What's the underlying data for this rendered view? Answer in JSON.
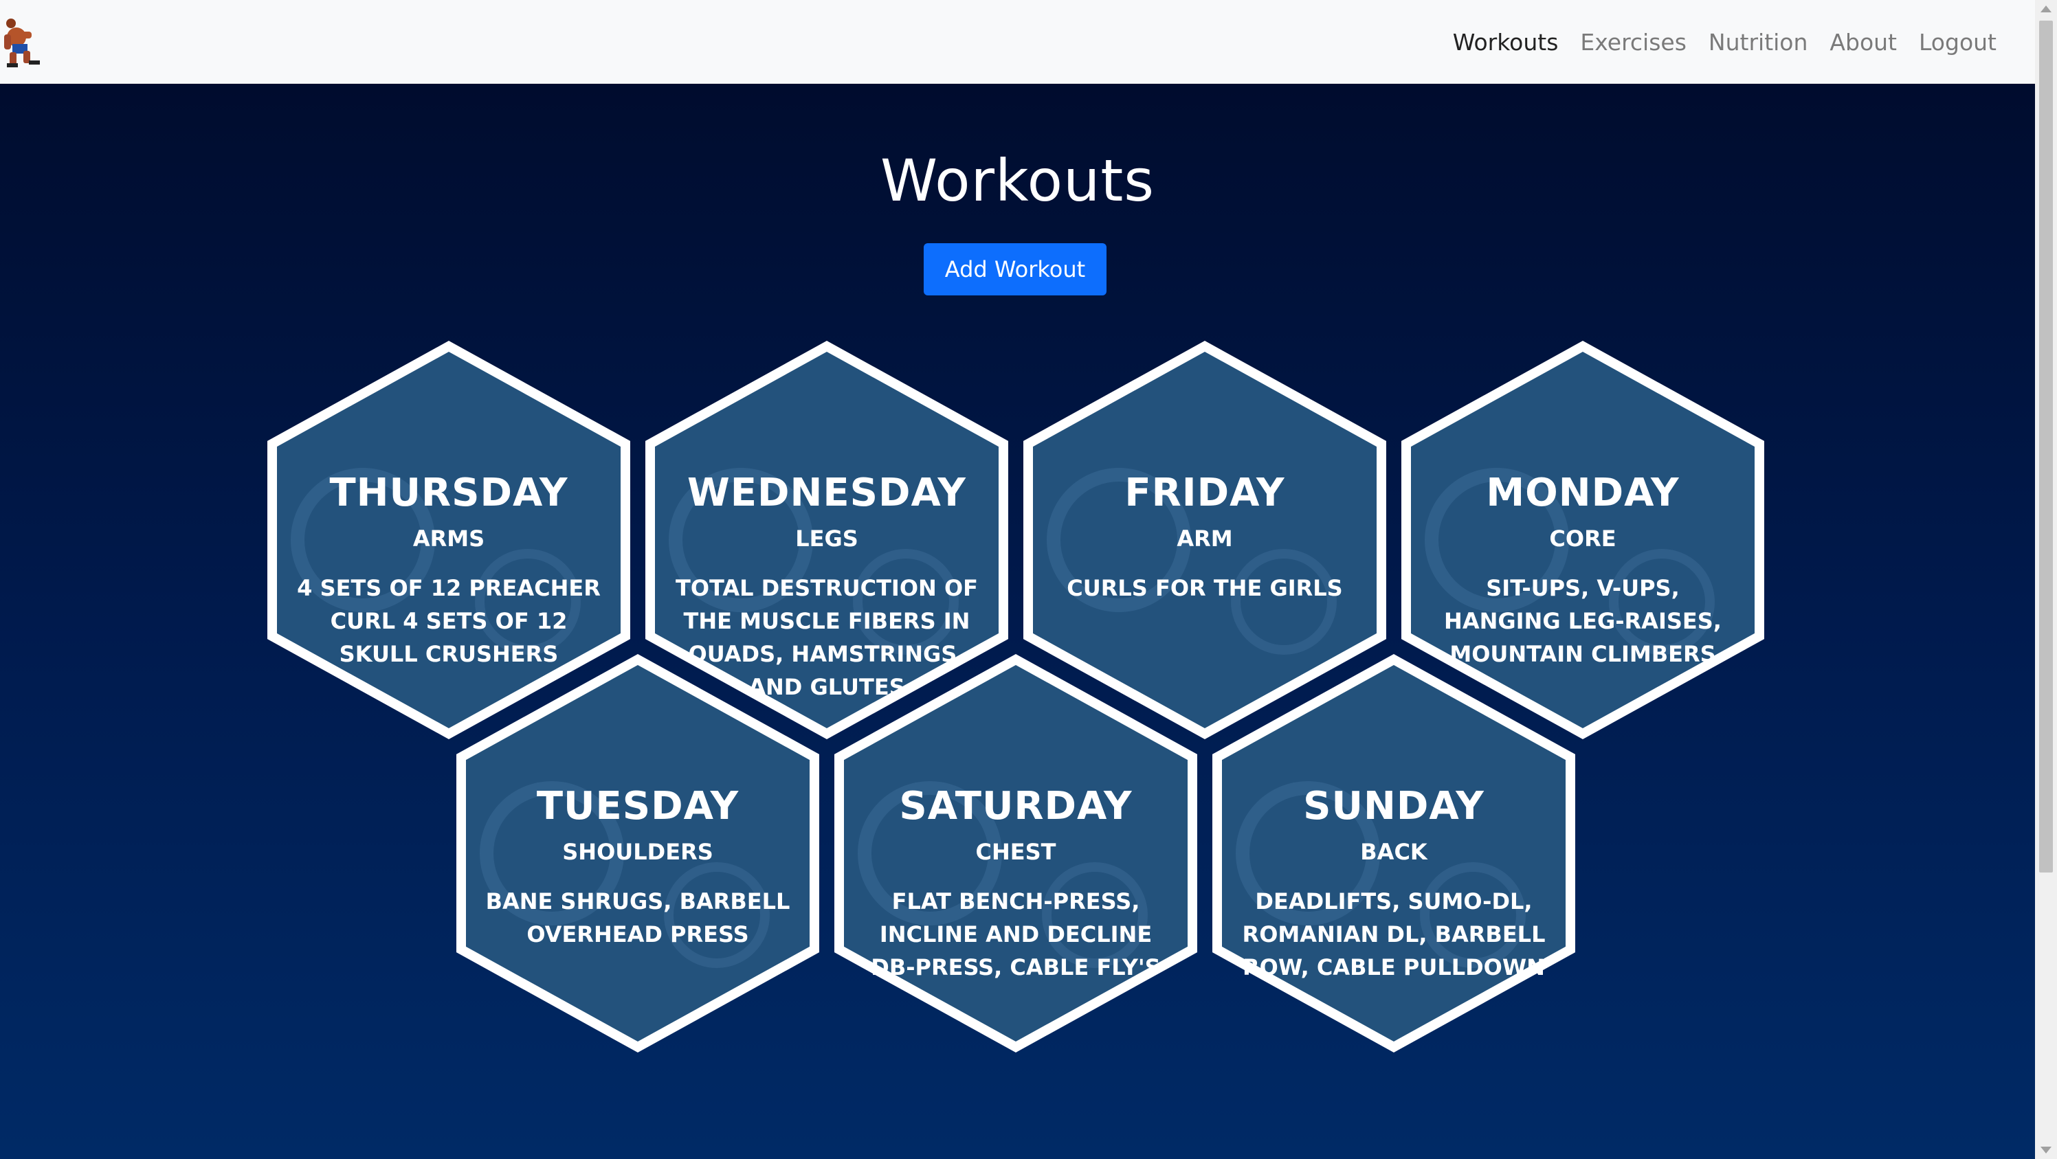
{
  "nav": {
    "items": [
      {
        "label": "Workouts",
        "active": true
      },
      {
        "label": "Exercises",
        "active": false
      },
      {
        "label": "Nutrition",
        "active": false
      },
      {
        "label": "About",
        "active": false
      },
      {
        "label": "Logout",
        "active": false
      }
    ]
  },
  "page": {
    "title": "Workouts",
    "add_button": "Add Workout"
  },
  "workouts": [
    {
      "day": "THURSDAY",
      "group": "ARMS",
      "desc": "4 SETS OF 12 PREACHER CURL 4 SETS OF 12 SKULL CRUSHERS"
    },
    {
      "day": "WEDNESDAY",
      "group": "LEGS",
      "desc": "TOTAL DESTRUCTION OF THE MUSCLE FIBERS IN QUADS, HAMSTRINGS, AND GLUTES"
    },
    {
      "day": "FRIDAY",
      "group": "ARM",
      "desc": "CURLS FOR THE GIRLS"
    },
    {
      "day": "MONDAY",
      "group": "CORE",
      "desc": "SIT-UPS, V-UPS, HANGING LEG-RAISES, MOUNTAIN CLIMBERS"
    },
    {
      "day": "TUESDAY",
      "group": "SHOULDERS",
      "desc": "BANE SHRUGS, BARBELL OVERHEAD PRESS"
    },
    {
      "day": "SATURDAY",
      "group": "CHEST",
      "desc": "FLAT BENCH-PRESS, INCLINE AND DECLINE DB-PRESS, CABLE FLY'S"
    },
    {
      "day": "SUNDAY",
      "group": "BACK",
      "desc": "DEADLIFTS, SUMO-DL, ROMANIAN DL, BARBELL ROW, CABLE PULLDOWN"
    }
  ],
  "colors": {
    "hex_fill": "#23527c",
    "hex_border": "#ffffff",
    "accent": "#0d6efd"
  }
}
